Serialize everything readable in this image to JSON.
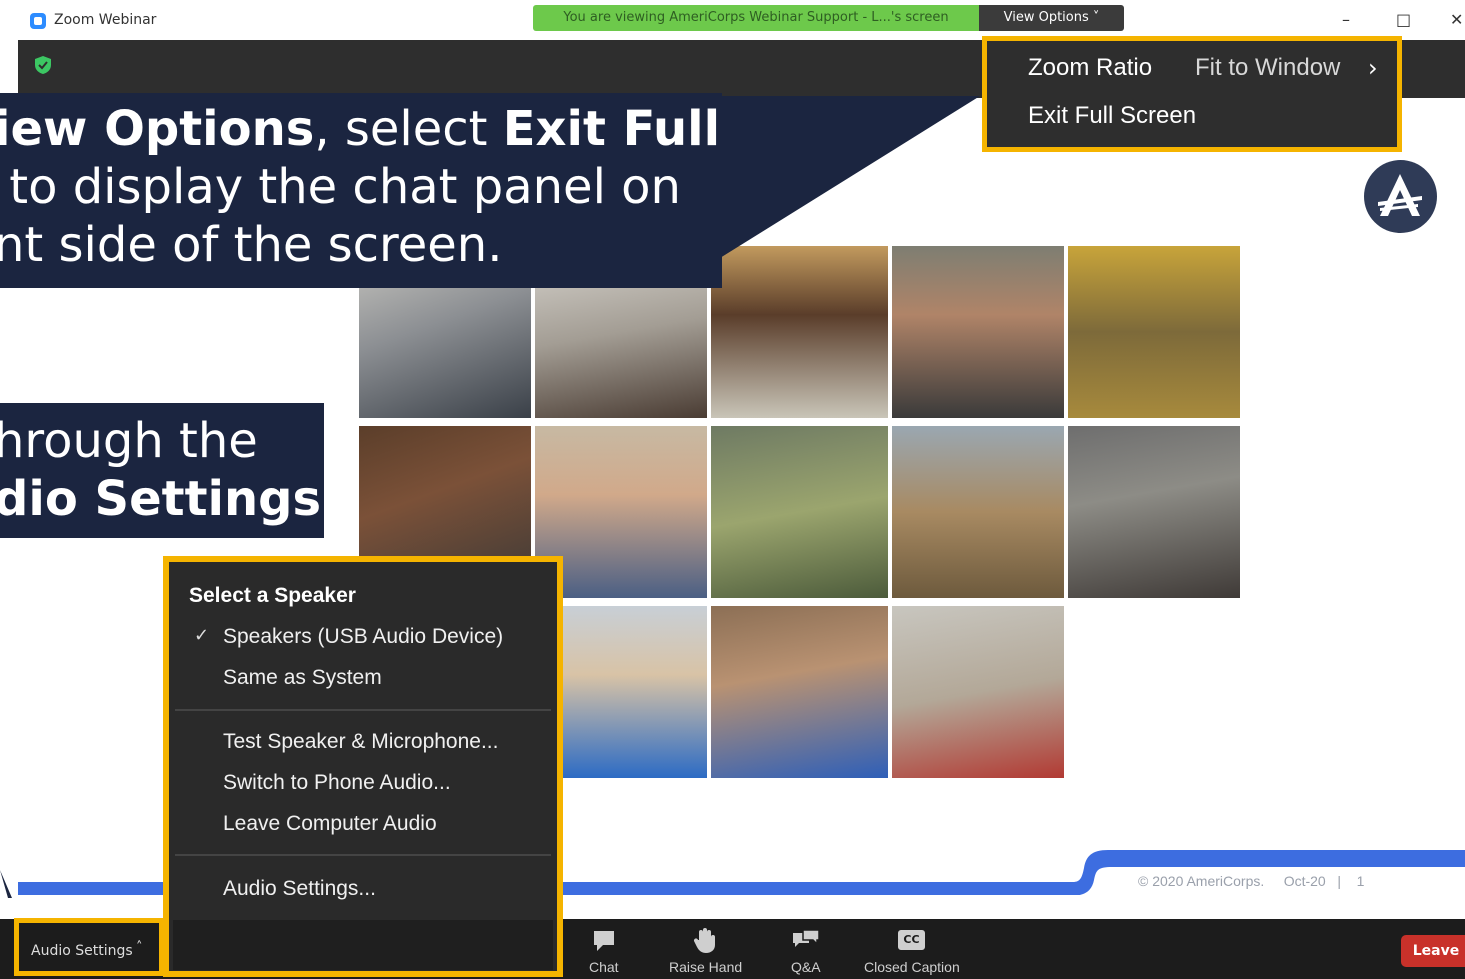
{
  "window": {
    "app_title": "Zoom Webinar",
    "sharing_banner": "You are viewing AmeriCorps Webinar Support - L...'s screen",
    "view_options_label": "View Options ˅",
    "minimize": "–",
    "maximize": "□",
    "close": "✕"
  },
  "zoom_menu": {
    "zoom_ratio_label": "Zoom Ratio",
    "zoom_ratio_value": "Fit to Window",
    "chevron": "›",
    "exit_full_screen": "Exit Full Screen"
  },
  "callout1": {
    "line1_bold1": "iew Options",
    "line1_plain": ", select ",
    "line1_bold2": "Exit Full",
    "line2": " to display the chat panel on",
    "line3": "nt side of the screen."
  },
  "callout2": {
    "line1": "hrough the",
    "line2_bold": "dio Settings",
    "line2_end": ")."
  },
  "audio_menu": {
    "header": "Select a Speaker",
    "check": "✓",
    "items": [
      "Speakers (USB Audio Device)",
      "Same as System",
      "Test Speaker & Microphone...",
      "Switch to Phone Audio...",
      "Leave Computer Audio",
      "Audio Settings..."
    ]
  },
  "slide": {
    "footer": "© 2020 AmeriCorps.     Oct-20   |    1"
  },
  "toolbar": {
    "audio_settings": "Audio Settings",
    "caret": "˄",
    "chat": "Chat",
    "raise_hand": "Raise Hand",
    "qa": "Q&A",
    "closed_caption": "Closed Caption",
    "cc_icon_text": "CC",
    "leave": "Leave"
  },
  "colors": {
    "highlight": "#f5b400",
    "callout_bg": "#1b2540",
    "banner_green": "#6dc94b",
    "leave_red": "#c8312a",
    "slide_blue": "#3d6de0"
  }
}
